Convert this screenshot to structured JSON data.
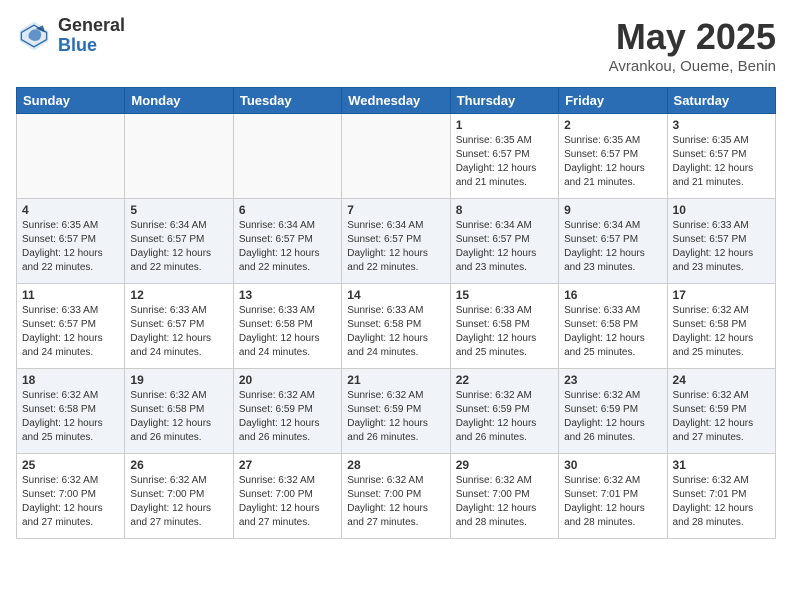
{
  "header": {
    "logo_general": "General",
    "logo_blue": "Blue",
    "month_title": "May 2025",
    "subtitle": "Avrankou, Oueme, Benin"
  },
  "weekdays": [
    "Sunday",
    "Monday",
    "Tuesday",
    "Wednesday",
    "Thursday",
    "Friday",
    "Saturday"
  ],
  "weeks": [
    [
      {
        "day": "",
        "info": ""
      },
      {
        "day": "",
        "info": ""
      },
      {
        "day": "",
        "info": ""
      },
      {
        "day": "",
        "info": ""
      },
      {
        "day": "1",
        "info": "Sunrise: 6:35 AM\nSunset: 6:57 PM\nDaylight: 12 hours\nand 21 minutes."
      },
      {
        "day": "2",
        "info": "Sunrise: 6:35 AM\nSunset: 6:57 PM\nDaylight: 12 hours\nand 21 minutes."
      },
      {
        "day": "3",
        "info": "Sunrise: 6:35 AM\nSunset: 6:57 PM\nDaylight: 12 hours\nand 21 minutes."
      }
    ],
    [
      {
        "day": "4",
        "info": "Sunrise: 6:35 AM\nSunset: 6:57 PM\nDaylight: 12 hours\nand 22 minutes."
      },
      {
        "day": "5",
        "info": "Sunrise: 6:34 AM\nSunset: 6:57 PM\nDaylight: 12 hours\nand 22 minutes."
      },
      {
        "day": "6",
        "info": "Sunrise: 6:34 AM\nSunset: 6:57 PM\nDaylight: 12 hours\nand 22 minutes."
      },
      {
        "day": "7",
        "info": "Sunrise: 6:34 AM\nSunset: 6:57 PM\nDaylight: 12 hours\nand 22 minutes."
      },
      {
        "day": "8",
        "info": "Sunrise: 6:34 AM\nSunset: 6:57 PM\nDaylight: 12 hours\nand 23 minutes."
      },
      {
        "day": "9",
        "info": "Sunrise: 6:34 AM\nSunset: 6:57 PM\nDaylight: 12 hours\nand 23 minutes."
      },
      {
        "day": "10",
        "info": "Sunrise: 6:33 AM\nSunset: 6:57 PM\nDaylight: 12 hours\nand 23 minutes."
      }
    ],
    [
      {
        "day": "11",
        "info": "Sunrise: 6:33 AM\nSunset: 6:57 PM\nDaylight: 12 hours\nand 24 minutes."
      },
      {
        "day": "12",
        "info": "Sunrise: 6:33 AM\nSunset: 6:57 PM\nDaylight: 12 hours\nand 24 minutes."
      },
      {
        "day": "13",
        "info": "Sunrise: 6:33 AM\nSunset: 6:58 PM\nDaylight: 12 hours\nand 24 minutes."
      },
      {
        "day": "14",
        "info": "Sunrise: 6:33 AM\nSunset: 6:58 PM\nDaylight: 12 hours\nand 24 minutes."
      },
      {
        "day": "15",
        "info": "Sunrise: 6:33 AM\nSunset: 6:58 PM\nDaylight: 12 hours\nand 25 minutes."
      },
      {
        "day": "16",
        "info": "Sunrise: 6:33 AM\nSunset: 6:58 PM\nDaylight: 12 hours\nand 25 minutes."
      },
      {
        "day": "17",
        "info": "Sunrise: 6:32 AM\nSunset: 6:58 PM\nDaylight: 12 hours\nand 25 minutes."
      }
    ],
    [
      {
        "day": "18",
        "info": "Sunrise: 6:32 AM\nSunset: 6:58 PM\nDaylight: 12 hours\nand 25 minutes."
      },
      {
        "day": "19",
        "info": "Sunrise: 6:32 AM\nSunset: 6:58 PM\nDaylight: 12 hours\nand 26 minutes."
      },
      {
        "day": "20",
        "info": "Sunrise: 6:32 AM\nSunset: 6:59 PM\nDaylight: 12 hours\nand 26 minutes."
      },
      {
        "day": "21",
        "info": "Sunrise: 6:32 AM\nSunset: 6:59 PM\nDaylight: 12 hours\nand 26 minutes."
      },
      {
        "day": "22",
        "info": "Sunrise: 6:32 AM\nSunset: 6:59 PM\nDaylight: 12 hours\nand 26 minutes."
      },
      {
        "day": "23",
        "info": "Sunrise: 6:32 AM\nSunset: 6:59 PM\nDaylight: 12 hours\nand 26 minutes."
      },
      {
        "day": "24",
        "info": "Sunrise: 6:32 AM\nSunset: 6:59 PM\nDaylight: 12 hours\nand 27 minutes."
      }
    ],
    [
      {
        "day": "25",
        "info": "Sunrise: 6:32 AM\nSunset: 7:00 PM\nDaylight: 12 hours\nand 27 minutes."
      },
      {
        "day": "26",
        "info": "Sunrise: 6:32 AM\nSunset: 7:00 PM\nDaylight: 12 hours\nand 27 minutes."
      },
      {
        "day": "27",
        "info": "Sunrise: 6:32 AM\nSunset: 7:00 PM\nDaylight: 12 hours\nand 27 minutes."
      },
      {
        "day": "28",
        "info": "Sunrise: 6:32 AM\nSunset: 7:00 PM\nDaylight: 12 hours\nand 27 minutes."
      },
      {
        "day": "29",
        "info": "Sunrise: 6:32 AM\nSunset: 7:00 PM\nDaylight: 12 hours\nand 28 minutes."
      },
      {
        "day": "30",
        "info": "Sunrise: 6:32 AM\nSunset: 7:01 PM\nDaylight: 12 hours\nand 28 minutes."
      },
      {
        "day": "31",
        "info": "Sunrise: 6:32 AM\nSunset: 7:01 PM\nDaylight: 12 hours\nand 28 minutes."
      }
    ]
  ]
}
